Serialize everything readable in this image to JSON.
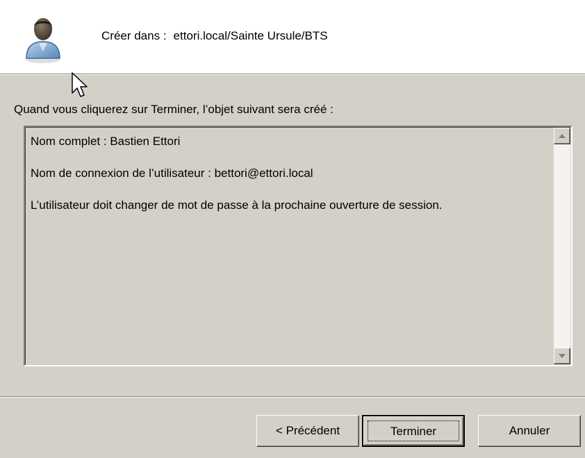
{
  "header": {
    "create_in_label": "Créer dans :",
    "create_in_path": "ettori.local/Sainte Ursule/BTS",
    "icon": "user-icon"
  },
  "intro_text": "Quand vous cliquerez sur Terminer, l’objet suivant sera créé :",
  "summary": {
    "lines": [
      "Nom complet : Bastien Ettori",
      "Nom de connexion de l’utilisateur : bettori@ettori.local",
      "L’utilisateur doit changer de mot de passe à la prochaine ouverture de session."
    ]
  },
  "buttons": {
    "previous": "< Précédent",
    "finish": "Terminer",
    "cancel": "Annuler"
  },
  "colors": {
    "dialog_bg": "#d4d0c8",
    "header_bg": "#ffffff"
  }
}
